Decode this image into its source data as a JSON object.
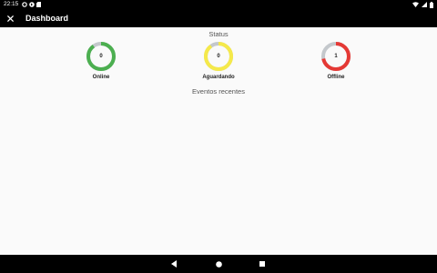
{
  "status_bar": {
    "time": "22:15",
    "left_icons": [
      "settings-icon",
      "notification-icon",
      "sd-card-icon"
    ],
    "right_icons": [
      "wifi-icon",
      "signal-icon",
      "battery-icon"
    ]
  },
  "app_bar": {
    "title": "Dashboard",
    "close_icon": "close-icon"
  },
  "status_section": {
    "title": "Status",
    "gauges": [
      {
        "label": "Online",
        "value": "0",
        "color": "#4caf50",
        "fraction": 0.9
      },
      {
        "label": "Aguardando",
        "value": "0",
        "color": "#f5e94a",
        "fraction": 0.9
      },
      {
        "label": "Offline",
        "value": "1",
        "color": "#e53935",
        "fraction": 0.72
      }
    ],
    "track_color": "#c4c8cc"
  },
  "events_section": {
    "title": "Eventos recentes"
  },
  "nav_bar": {
    "buttons": [
      "back-icon",
      "home-icon",
      "recents-icon"
    ]
  }
}
